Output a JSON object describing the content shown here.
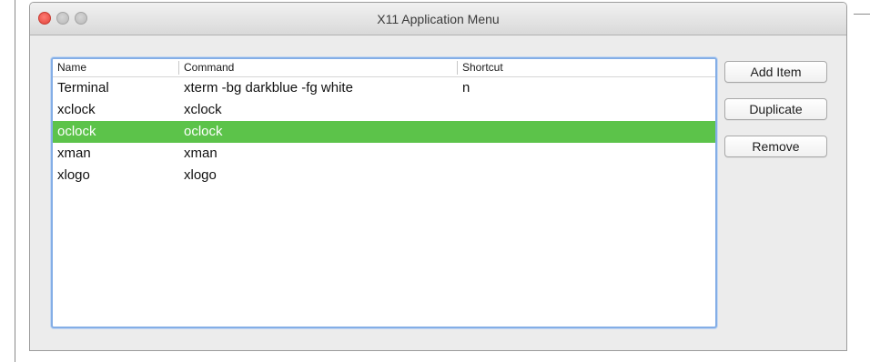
{
  "window": {
    "title": "X11 Application Menu"
  },
  "table": {
    "columns": [
      "Name",
      "Command",
      "Shortcut"
    ],
    "rows": [
      {
        "name": "Terminal",
        "command": "xterm -bg darkblue -fg white",
        "shortcut": "n",
        "selected": false
      },
      {
        "name": "xclock",
        "command": "xclock",
        "shortcut": "",
        "selected": false
      },
      {
        "name": "oclock",
        "command": "oclock",
        "shortcut": "",
        "selected": true
      },
      {
        "name": "xman",
        "command": "xman",
        "shortcut": "",
        "selected": false
      },
      {
        "name": "xlogo",
        "command": "xlogo",
        "shortcut": "",
        "selected": false
      }
    ]
  },
  "buttons": {
    "add_item": "Add Item",
    "duplicate": "Duplicate",
    "remove": "Remove"
  },
  "colors": {
    "selection": "#5cc34a",
    "focus_ring": "#84aee6"
  }
}
